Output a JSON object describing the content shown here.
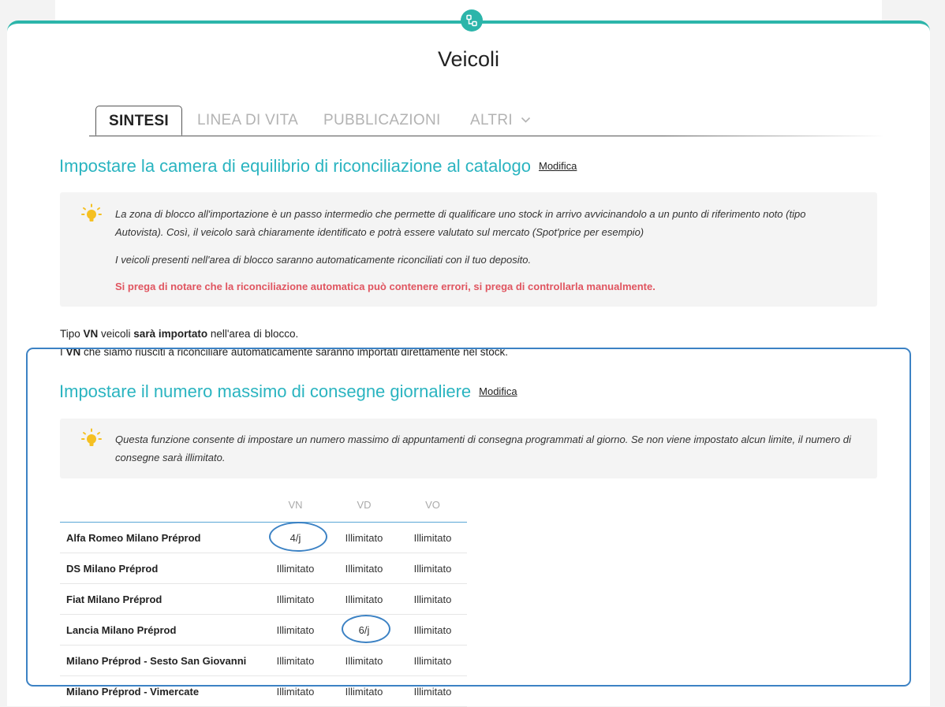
{
  "page": {
    "title": "Veicoli",
    "accent_color": "#2cb5aa",
    "icon": "network-nodes-icon"
  },
  "tabs": [
    {
      "label": "SINTESI",
      "active": true
    },
    {
      "label": "LINEA DI VITA",
      "active": false
    },
    {
      "label": "PUBBLICAZIONI",
      "active": false
    },
    {
      "label": "ALTRI",
      "active": false,
      "icon": "chevron-down-icon"
    }
  ],
  "section1": {
    "title": "Impostare la camera di equilibrio di riconciliazione al catalogo",
    "edit_link": "Modifica",
    "info": {
      "icon": "lightbulb-icon",
      "para1": "La zona di blocco all'importazione è un passo intermedio che permette di qualificare uno stock in arrivo avvicinandolo a un punto di riferimento noto (tipo Autovista). Così, il veicolo sarà chiaramente identificato e potrà essere valutato sul mercato (Spot'price per esempio)",
      "para2": "I veicoli presenti nell'area di blocco saranno automaticamente riconciliati con il tuo deposito.",
      "warning": "Si prega di notare che la riconciliazione automatica può contenere errori, si prega di controllarla manualmente."
    },
    "line1": {
      "a": "Tipo ",
      "b": "VN",
      "c": " veicoli ",
      "d": "sarà importato",
      "e": " nell'area di blocco."
    },
    "line2": {
      "a": "I ",
      "b": "VN",
      "c": " che siamo riusciti a riconciliare automaticamente saranno importati direttamente nel stock."
    }
  },
  "section2": {
    "title": "Impostare il numero massimo di consegne giornaliere",
    "edit_link": "Modifica",
    "info": {
      "icon": "lightbulb-icon",
      "text": "Questa funzione consente di impostare un numero massimo di appuntamenti di consegna programmati al giorno. Se non viene impostato alcun limite, il numero di consegne sarà illimitato."
    },
    "table": {
      "columns": [
        "VN",
        "VD",
        "VO"
      ],
      "rows": [
        {
          "name": "Alfa Romeo Milano Préprod",
          "vn": "4/j",
          "vd": "Illimitato",
          "vo": "Illimitato"
        },
        {
          "name": "DS Milano Préprod",
          "vn": "Illimitato",
          "vd": "Illimitato",
          "vo": "Illimitato"
        },
        {
          "name": "Fiat Milano Préprod",
          "vn": "Illimitato",
          "vd": "Illimitato",
          "vo": "Illimitato"
        },
        {
          "name": "Lancia Milano Préprod",
          "vn": "Illimitato",
          "vd": "6/j",
          "vo": "Illimitato"
        },
        {
          "name": "Milano Préprod - Sesto San Giovanni",
          "vn": "Illimitato",
          "vd": "Illimitato",
          "vo": "Illimitato"
        },
        {
          "name": "Milano Préprod - Vimercate",
          "vn": "Illimitato",
          "vd": "Illimitato",
          "vo": "Illimitato"
        }
      ]
    }
  },
  "colors": {
    "section_title": "#2ab4c0",
    "warning": "#e05560",
    "highlight_outline": "#3c82c4"
  }
}
